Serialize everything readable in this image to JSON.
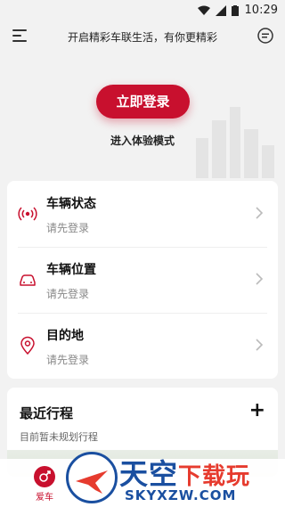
{
  "status_bar": {
    "time": "10:29"
  },
  "header": {
    "title": "开启精彩车联生活，有你更精彩"
  },
  "hero": {
    "login_label": "立即登录",
    "trial_label": "进入体验模式"
  },
  "vehicle_card": {
    "rows": [
      {
        "title": "车辆状态",
        "subtitle": "请先登录",
        "icon": "signal-icon"
      },
      {
        "title": "车辆位置",
        "subtitle": "请先登录",
        "icon": "car-icon"
      },
      {
        "title": "目的地",
        "subtitle": "请先登录",
        "icon": "location-pin-icon"
      }
    ]
  },
  "trip_card": {
    "title": "最近行程",
    "subtitle": "目前暂未规划行程",
    "add_symbol": "+"
  },
  "tabbar": {
    "tabs": [
      {
        "label": "爱车",
        "active": true
      }
    ]
  },
  "watermark": {
    "main_text": "天空",
    "accent_text": "下载玩",
    "url": "SKYXZW.COM"
  },
  "colors": {
    "accent": "#c8102e",
    "watermark_blue": "#1a4fa0",
    "watermark_red": "#e63b2e"
  }
}
